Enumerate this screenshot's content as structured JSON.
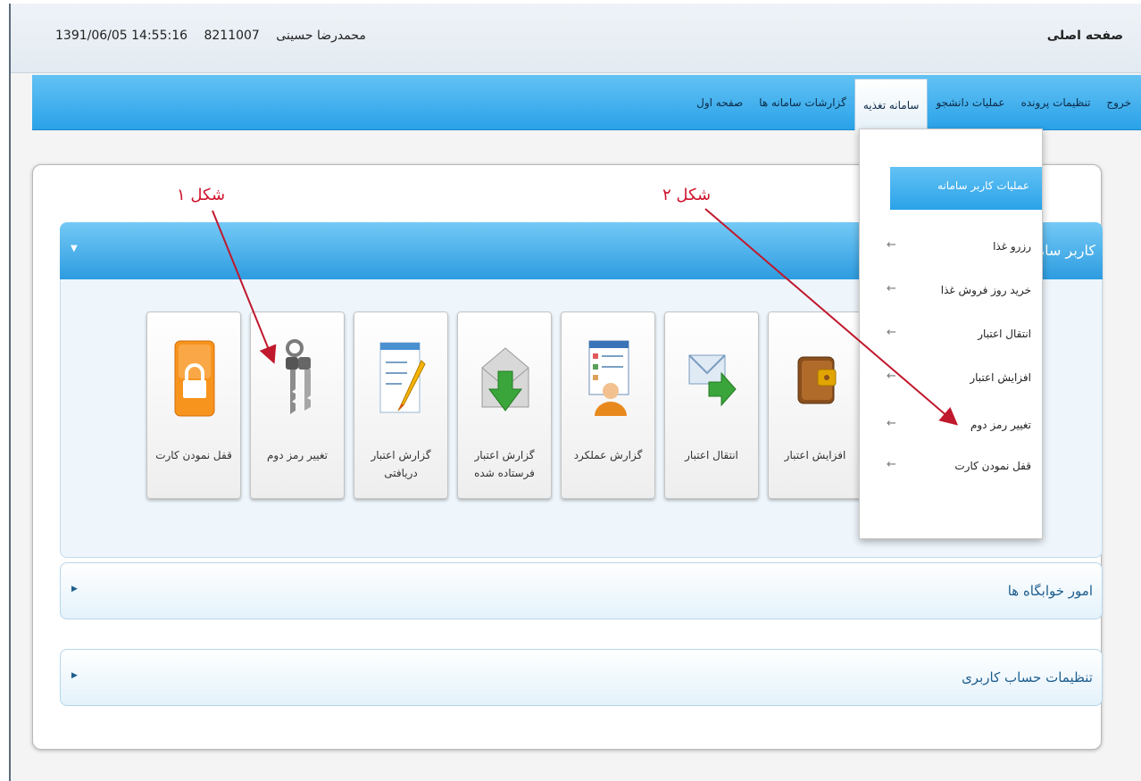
{
  "header": {
    "title": "صفحه اصلی",
    "user_name": "محمدرضا حسینی",
    "user_id": "8211007",
    "datetime": "1391/06/05 14:55:16"
  },
  "nav": {
    "items": [
      {
        "label": "صفحه اول",
        "active": false
      },
      {
        "label": "گزارشات سامانه ها",
        "active": false
      },
      {
        "label": "سامانه تغذیه",
        "active": true
      },
      {
        "label": "عملیات دانشجو",
        "active": false
      },
      {
        "label": "تنظیمات پرونده",
        "active": false
      },
      {
        "label": "خروج",
        "active": false
      }
    ]
  },
  "dropdown": {
    "heading": "عملیات کاربر سامانه",
    "items": [
      {
        "label": "رزرو غذا"
      },
      {
        "label": "خرید روز فروش غذا"
      },
      {
        "label": "انتقال اعتبار"
      },
      {
        "label": "افزایش اعتبار"
      },
      {
        "label": "تغییر رمز دوم"
      },
      {
        "label": "قفل نمودن کارت"
      }
    ]
  },
  "sections": {
    "user_system": {
      "title": "کاربر سامانه"
    },
    "dormitory": {
      "title": "امور خوابگاه ها"
    },
    "account": {
      "title": "تنظیمات حساب کاربری"
    }
  },
  "tiles": [
    {
      "label": "قفل نمودن کارت",
      "icon": "lock-icon"
    },
    {
      "label": "تغییر رمز دوم",
      "icon": "keys-icon"
    },
    {
      "label": "گزارش اعتبار دریافتی",
      "icon": "notepad-pencil-icon"
    },
    {
      "label": "گزارش اعتبار فرستاده شده",
      "icon": "envelope-download-icon"
    },
    {
      "label": "گزارش عملکرد",
      "icon": "person-report-icon"
    },
    {
      "label": "انتقال اعتبار",
      "icon": "mail-forward-icon"
    },
    {
      "label": "افزایش اعتبار",
      "icon": "wallet-icon"
    }
  ],
  "annotations": {
    "fig1": "شکل ۱",
    "fig2": "شکل ۲"
  },
  "colors": {
    "nav_blue": "#2aa2e8",
    "annotation_red": "#d0142c",
    "header_text": "#222222"
  }
}
